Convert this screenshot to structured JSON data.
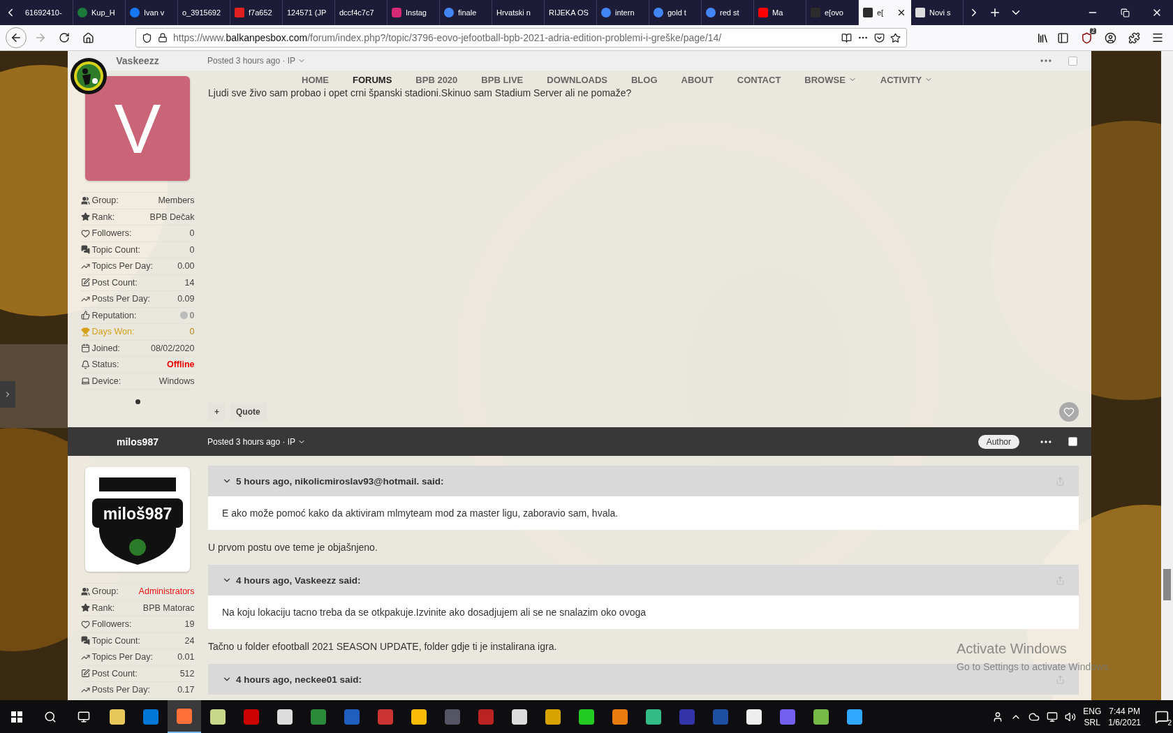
{
  "browser": {
    "tabs": [
      {
        "title": "61692410-",
        "selected": false
      },
      {
        "title": "Kup_H",
        "selected": false
      },
      {
        "title": "Ivan v",
        "selected": false
      },
      {
        "title": "o_3915692",
        "selected": false
      },
      {
        "title": "f7a652",
        "selected": false
      },
      {
        "title": "124571 (JP",
        "selected": false
      },
      {
        "title": "dccf4c7c7",
        "selected": false
      },
      {
        "title": "Instag",
        "selected": false
      },
      {
        "title": "finale",
        "selected": false
      },
      {
        "title": "Hrvatski n",
        "selected": false
      },
      {
        "title": "RIJEKA OS",
        "selected": false
      },
      {
        "title": "intern",
        "selected": false
      },
      {
        "title": "gold t",
        "selected": false
      },
      {
        "title": "red st",
        "selected": false
      },
      {
        "title": "Ma",
        "selected": false
      },
      {
        "title": "e[ovo",
        "selected": false
      },
      {
        "title": "e[",
        "selected": true
      },
      {
        "title": "Novi s",
        "selected": false
      }
    ],
    "url": {
      "prefix": "https://www.",
      "domain": "balkanpesbox.com",
      "path": "/forum/index.php?/topic/3796-eovo-jefootball-bpb-2021-adria-edition-problemi-i-greške/page/14/"
    },
    "addon_badge": "2"
  },
  "site_nav": {
    "items": [
      {
        "label": "HOME",
        "selected": false,
        "dropdown": false
      },
      {
        "label": "FORUMS",
        "selected": true,
        "dropdown": false
      },
      {
        "label": "BPB 2020",
        "selected": false,
        "dropdown": false
      },
      {
        "label": "BPB LIVE",
        "selected": false,
        "dropdown": false
      },
      {
        "label": "DOWNLOADS",
        "selected": false,
        "dropdown": false
      },
      {
        "label": "BLOG",
        "selected": false,
        "dropdown": false
      },
      {
        "label": "ABOUT",
        "selected": false,
        "dropdown": false
      },
      {
        "label": "CONTACT",
        "selected": false,
        "dropdown": false
      },
      {
        "label": "BROWSE",
        "selected": false,
        "dropdown": true
      },
      {
        "label": "ACTIVITY",
        "selected": false,
        "dropdown": true
      }
    ]
  },
  "posts": [
    {
      "author": "Vaskeezz",
      "posted": "Posted 3 hours ago · IP",
      "selected": false,
      "avatar": {
        "kind": "letter",
        "letter": "V"
      },
      "stats": [
        {
          "label": "Group:",
          "value": "Members",
          "kind": "plain"
        },
        {
          "label": "Rank:",
          "value": "BPB Dečak",
          "kind": "plain"
        },
        {
          "label": "Followers:",
          "value": "0",
          "kind": "plain"
        },
        {
          "label": "Topic Count:",
          "value": "0",
          "kind": "plain"
        },
        {
          "label": "Topics Per Day:",
          "value": "0.00",
          "kind": "plain"
        },
        {
          "label": "Post Count:",
          "value": "14",
          "kind": "plain"
        },
        {
          "label": "Posts Per Day:",
          "value": "0.09",
          "kind": "plain"
        },
        {
          "label": "Reputation:",
          "value": "0",
          "kind": "reputation"
        },
        {
          "label": "Days Won:",
          "value": "0",
          "kind": "award"
        },
        {
          "label": "Joined:",
          "value": "08/02/2020",
          "kind": "plain"
        },
        {
          "label": "Status:",
          "value": "Offline",
          "kind": "status",
          "color": "#ee0000"
        },
        {
          "label": "Device:",
          "value": "Windows",
          "kind": "plain"
        }
      ],
      "content": [
        {
          "kind": "text",
          "text": "Ljudi sve živo sam probao i opet crni španski stadioni.Skinuo sam Stadium Server ali ne pomaže?"
        }
      ],
      "actions": {
        "add": "+",
        "quote": "Quote"
      }
    },
    {
      "author": "milos987",
      "posted": "Posted 3 hours ago · IP",
      "selected": false,
      "avatar": {
        "kind": "logo",
        "letter": "miloš987"
      },
      "badge": "Author",
      "stats": [
        {
          "label": "Group:",
          "value": "Administrators",
          "kind": "plain",
          "color": "#ee1111"
        },
        {
          "label": "Rank:",
          "value": "BPB Matorac",
          "kind": "plain"
        },
        {
          "label": "Followers:",
          "value": "19",
          "kind": "plain"
        },
        {
          "label": "Topic Count:",
          "value": "24",
          "kind": "plain"
        },
        {
          "label": "Topics Per Day:",
          "value": "0.01",
          "kind": "plain"
        },
        {
          "label": "Post Count:",
          "value": "512",
          "kind": "plain"
        },
        {
          "label": "Posts Per Day:",
          "value": "0.17",
          "kind": "plain"
        }
      ],
      "content": [
        {
          "kind": "quote",
          "citation": "5 hours ago, nikolicmiroslav93@hotmail. said:",
          "text": "E ako može pomoć kako da aktiviram mlmyteam mod za master ligu, zaboravio sam, hvala."
        },
        {
          "kind": "text",
          "text": "U prvom postu ove teme je objašnjeno."
        },
        {
          "kind": "quote",
          "citation": "4 hours ago, Vaskeezz said:",
          "text": "Na koju lokaciju tacno treba da se otkpakuje.Izvinite ako dosadjujem ali se ne snalazim oko ovoga"
        },
        {
          "kind": "text",
          "text": "Tačno u folder efootball 2021 SEASON UPDATE, folder gdje ti je instalirana igra."
        },
        {
          "kind": "quote",
          "citation": "4 hours ago, neckee01 said:"
        }
      ]
    }
  ],
  "activation": {
    "title": "Activate Windows",
    "hint": "Go to Settings to activate Windows."
  },
  "taskbar": {
    "language": "ENG",
    "layout": "SRL",
    "time": "7:44 PM",
    "date": "1/6/2021",
    "notifications": "2"
  }
}
